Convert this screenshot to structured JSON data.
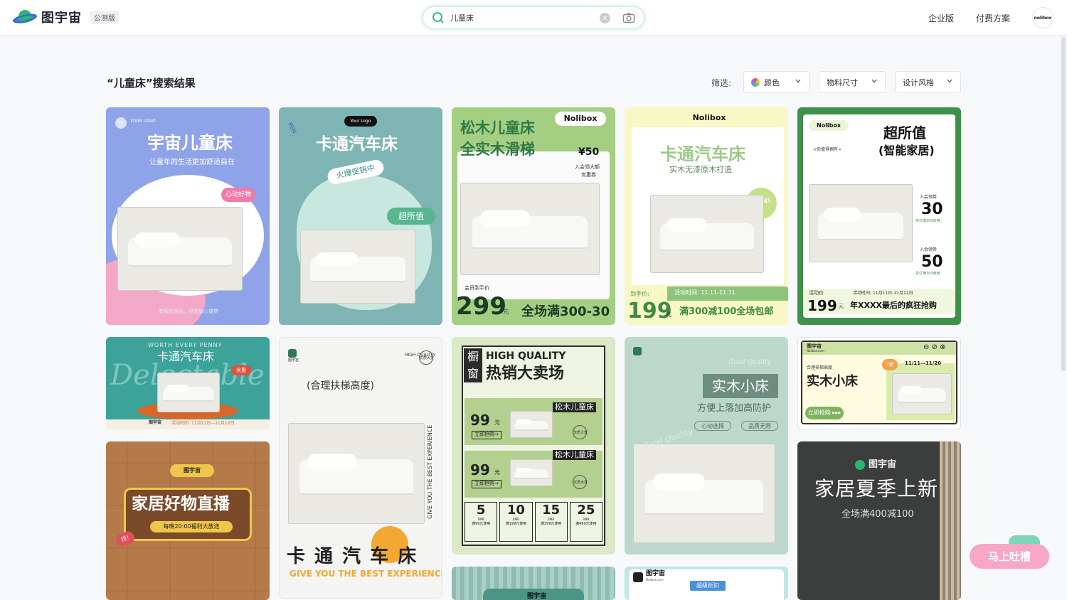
{
  "header": {
    "brand": "图宇宙",
    "beta_badge": "公测版",
    "search_value": "儿童床",
    "nav_enterprise": "企业版",
    "nav_pricing": "付费方案",
    "avatar_text": "nolibox",
    "colors": {
      "accent": "#2bb673",
      "search_border": "#c6ead8"
    }
  },
  "results": {
    "title": "“儿童床”搜索结果",
    "filter_label": "筛选:",
    "filters": [
      "颜色",
      "物料尺寸",
      "设计风格"
    ]
  },
  "cards": {
    "c1": {
      "logo_small": "YOUR LOGO",
      "title": "宇宙儿童床",
      "subtitle": "让童年的生活更加舒适自在",
      "sticker": "心动好物",
      "footer": "有我在背后，尽管放心做梦"
    },
    "c2": {
      "your_logo": "Your Logo",
      "pen": "PEN",
      "title": "卡通汽车床",
      "banner": "火爆促销中",
      "badge": "超所值"
    },
    "c3": {
      "title_1": "松木儿童床",
      "title_2": "全实木滑梯",
      "brand": "Nolibox",
      "coupon": "¥50",
      "coupon_note_1": "入会领大额",
      "coupon_note_2": "优惠券",
      "price_label": "会员到手价",
      "price": "299",
      "unit": "元",
      "promo": "全场满300-30"
    },
    "c4": {
      "brand": "Nolibox",
      "title": "卡通汽车床",
      "subtitle": "实木无漆原木打造",
      "sticker": "NEW!",
      "price_label": "到手价:",
      "price": "199",
      "unit": "元",
      "event_time": "活动时间: 11.11-11.11",
      "promo": "满300减100全场包邮"
    },
    "c5": {
      "brand": "Nolibox",
      "headline_1": "超所值",
      "headline_2": "(智能家居)",
      "tagline": "<你值得拥有>",
      "c1_label": "入会领券",
      "c1_value": "30",
      "c1_note": "实付满200使用",
      "c2_label": "入会领券",
      "c2_value": "50",
      "c2_note": "实付满300使用",
      "price_label": "活动价",
      "price": "199",
      "unit": "元",
      "event_time": "活动时间: 11月11日-11月12日",
      "promo": "年XXXX最后的疯狂抢购"
    },
    "c6": {
      "top": "WORTH EVERY PENNY",
      "title": "卡通汽车床",
      "script": "Delectable",
      "badge": "优惠",
      "brand": "图宇宙",
      "event": "活动时间: 11月11日—11月12日"
    },
    "c7": {
      "brand": "图宇宙",
      "quality": "HIGH QUALITY",
      "seal": "优质大赏",
      "subtitle": "(合理扶梯高度)",
      "vertical": "GIVE YOU THE BEST EXPERIENCE",
      "title": "卡 通 汽 车 床",
      "footer": "GIVE YOU THE BEST EXPERIENCE"
    },
    "c8": {
      "window": "橱窗",
      "quality": "HIGH QUALITY",
      "title": "热销大卖场",
      "item_name": "松木儿童床",
      "item_price": "99",
      "unit": "元",
      "buy": "立即抢购→",
      "seal": "优质大赏",
      "coupons": [
        {
          "v": "5",
          "n": "满99元使用"
        },
        {
          "v": "10",
          "n": "满199元使用"
        },
        {
          "v": "15",
          "n": "满399元使用"
        },
        {
          "v": "25",
          "n": "满499元使用"
        }
      ],
      "rmb": "RMB"
    },
    "c9": {
      "script_top": "Good Quality",
      "title": "实木小床",
      "subtitle": "方便上落加高防护",
      "tag1": "心动选择",
      "tag2": "品质无限",
      "script_left": "Good Quality"
    },
    "c10": {
      "brand": "图宇宙",
      "site": "Nolibox.com",
      "label": "合理扶梯高度",
      "title": "实木小床",
      "discount": "7折",
      "date": "11/11—11/20",
      "cta": "立即抢购 ▸▸▸"
    },
    "c11": {
      "badge": "图宇宙",
      "title": "家居好物直播",
      "subtitle": "每晚20:00福利大放送",
      "tag": "抢!"
    },
    "c12": {
      "brand": "图宇宙",
      "title": "家居夏季上新",
      "subtitle": "全场满400减100"
    },
    "c13": {
      "brand": "图宇宙"
    },
    "c14": {
      "brand": "图宇宙",
      "site": "Nolibox.com",
      "badge": "超级折扣"
    }
  },
  "float_button": "马上吐槽"
}
